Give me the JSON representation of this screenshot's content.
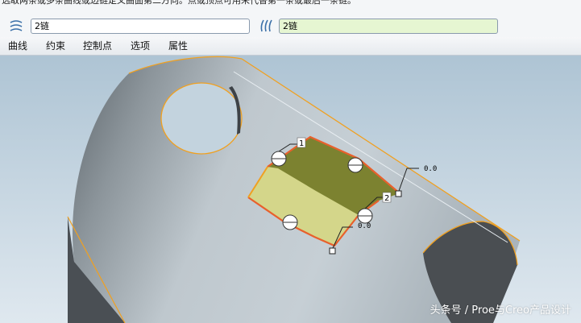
{
  "hint": {
    "text": "选取两条或多条曲线或边链定义曲面第二方向。点或顶点可用来代替第一条或最后一条链。"
  },
  "chains": {
    "first": {
      "icon": "surface-first-direction-icon",
      "value": "2链"
    },
    "second": {
      "icon": "surface-second-direction-icon",
      "value": "2链"
    }
  },
  "tabs": [
    {
      "label": "曲线"
    },
    {
      "label": "约束"
    },
    {
      "label": "控制点"
    },
    {
      "label": "选项"
    },
    {
      "label": "属性"
    }
  ],
  "viewport": {
    "labels": {
      "chain1": "1",
      "chain2": "2",
      "value_top": "0.0",
      "value_bottom": "0.0"
    },
    "colors": {
      "edge": "#f0a020",
      "surface_dark": "#7c8230",
      "surface_light": "#d4d68a",
      "highlight": "#e8602c"
    }
  },
  "watermark": {
    "text": "头条号 / Proe与Creo产品设计"
  }
}
